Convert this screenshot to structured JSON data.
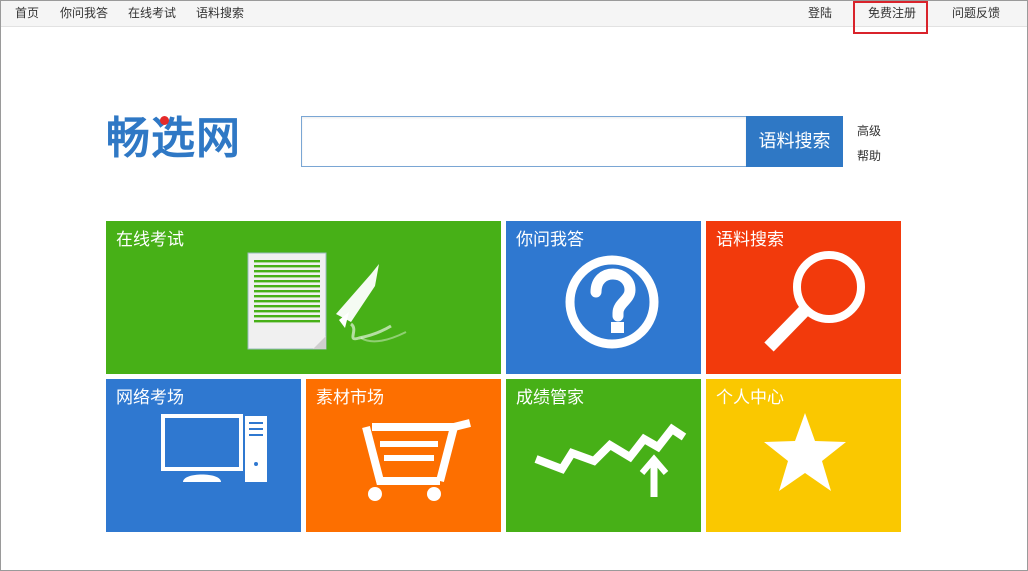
{
  "topnav": {
    "home": "首页",
    "qa": "你问我答",
    "exam": "在线考试",
    "corpus": "语料搜索",
    "login": "登陆",
    "register": "免费注册",
    "feedback": "问题反馈"
  },
  "logo": {
    "text": "畅选网"
  },
  "search": {
    "value": "",
    "placeholder": "",
    "button_label": "语料搜索",
    "advanced": "高级",
    "help": "帮助"
  },
  "tiles": [
    {
      "label": "在线考试",
      "color": "#47b017",
      "icon": "exam-paper-pen-icon"
    },
    {
      "label": "你问我答",
      "color": "#2f78d0",
      "icon": "question-circle-icon"
    },
    {
      "label": "语料搜索",
      "color": "#f23a0c",
      "icon": "magnifier-icon"
    },
    {
      "label": "网络考场",
      "color": "#2f78d0",
      "icon": "computer-icon"
    },
    {
      "label": "素材市场",
      "color": "#fd6f00",
      "icon": "shopping-cart-icon"
    },
    {
      "label": "成绩管家",
      "color": "#47b017",
      "icon": "rising-chart-icon"
    },
    {
      "label": "个人中心",
      "color": "#fac800",
      "icon": "star-icon"
    }
  ]
}
